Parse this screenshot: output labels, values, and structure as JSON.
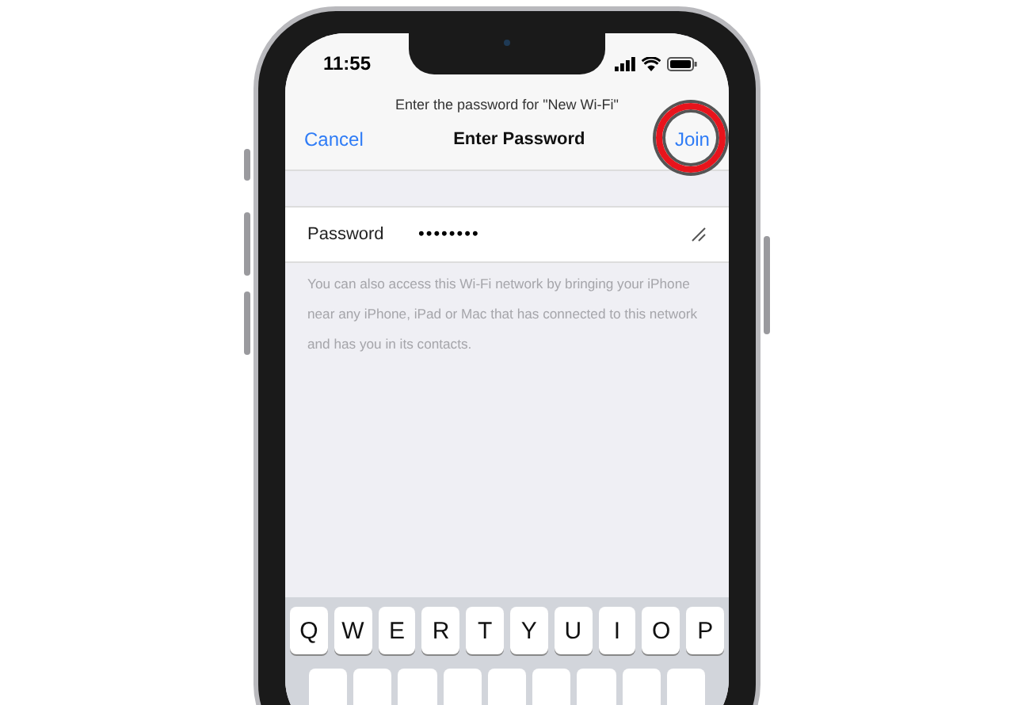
{
  "status_bar": {
    "time": "11:55"
  },
  "prompt": "Enter the password for \"New Wi-Fi\"",
  "nav": {
    "cancel": "Cancel",
    "title": "Enter Password",
    "join": "Join",
    "join_highlighted": true
  },
  "field": {
    "label": "Password",
    "value": "••••••••"
  },
  "footer": "You can also access this Wi-Fi network by bringing your iPhone near any iPhone, iPad or Mac that has connected to this network and has you in its contacts.",
  "keyboard": {
    "rows": [
      [
        "Q",
        "W",
        "E",
        "R",
        "T",
        "Y",
        "U",
        "I",
        "O",
        "P"
      ]
    ]
  }
}
